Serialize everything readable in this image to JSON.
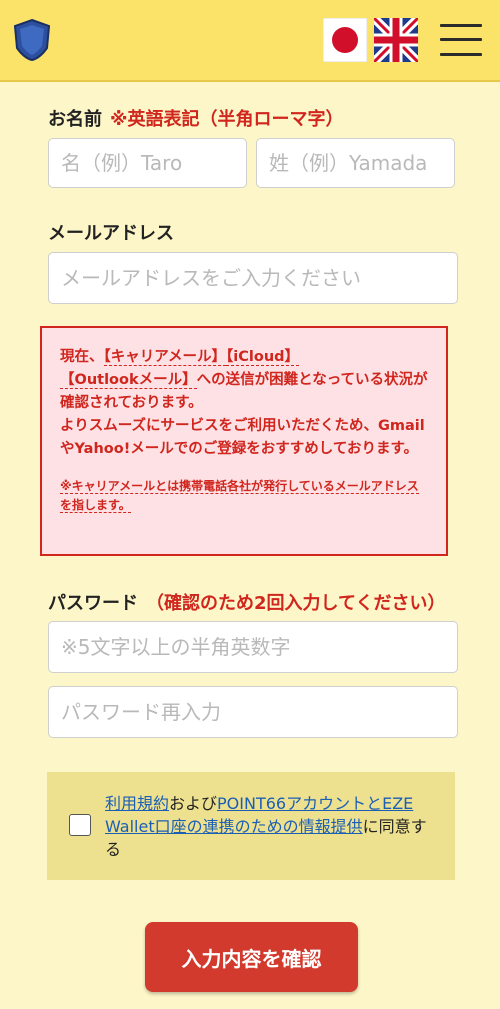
{
  "header": {
    "logo_icon": "shield-badge-icon",
    "languages": [
      {
        "code": "ja",
        "icon": "japan-flag-icon"
      },
      {
        "code": "en",
        "icon": "uk-flag-icon"
      }
    ],
    "menu_icon": "hamburger-menu-icon"
  },
  "name_section": {
    "label": "お名前",
    "note": "※英語表記（半角ローマ字）",
    "first_name_placeholder": "名（例）Taro",
    "last_name_placeholder": "姓（例）Yamada"
  },
  "email_section": {
    "label": "メールアドレス",
    "placeholder": "メールアドレスをご入力ください"
  },
  "warning": {
    "line1_prefix": "現在、",
    "carrier": "【キャリアメール】",
    "icloud": "【iCloud】",
    "outlook": "【Outlookメール】",
    "line1_suffix": "への送信が困難となっている状況が確認されております。",
    "line2": "よりスムーズにサービスをご利用いただくため、GmailやYahoo!メールでのご登録をおすすめしております。",
    "footnote": "※キャリアメールとは携帯電話各社が発行しているメールアドレスを指します。"
  },
  "password_section": {
    "label": "パスワード",
    "note": "（確認のため2回入力してください）",
    "password_placeholder": "※5文字以上の半角英数字",
    "confirm_placeholder": "パスワード再入力"
  },
  "agreement": {
    "terms_link": "利用規約",
    "and_text": "および",
    "info_link": "POINT66アカウントとEZE Wallet口座の連携のための情報提供",
    "suffix": "に同意する",
    "checked": false
  },
  "submit": {
    "label": "入力内容を確認"
  },
  "colors": {
    "header_bg": "#fbe36a",
    "page_bg": "#fdf6c8",
    "accent_red": "#d13a2d",
    "link_blue": "#1b5fb5",
    "warning_bg": "#fde1e4"
  }
}
